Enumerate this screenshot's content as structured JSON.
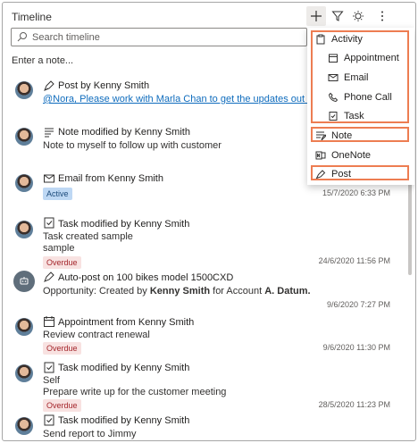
{
  "header": {
    "title": "Timeline"
  },
  "search": {
    "placeholder": "Search timeline"
  },
  "note_input": {
    "placeholder": "Enter a note..."
  },
  "items": [
    {
      "title": "Post by Kenny Smith",
      "link": "@Nora, Please work with Marla Chan to get the updates out today.",
      "icon": "post-icon"
    },
    {
      "title": "Note modified by Kenny Smith",
      "line1": "Note to myself to follow up with customer",
      "icon": "note-icon"
    },
    {
      "title": "Email from Kenny Smith",
      "badge": "Active",
      "timestamp": "15/7/2020 6:33 PM",
      "icon": "email-icon"
    },
    {
      "title": "Task modified by Kenny Smith",
      "line1": "Task created sample",
      "line2": "sample",
      "badge": "Overdue",
      "timestamp": "24/6/2020 11:56 PM",
      "icon": "task-icon"
    },
    {
      "title": "Auto-post on 100 bikes model 1500CXD",
      "line1_prefix": "Opportunity: Created by ",
      "line1_bold1": "Kenny Smith",
      "line1_mid": " for Account ",
      "line1_bold2": "A. Datum.",
      "timestamp": "9/6/2020 7:27 PM",
      "icon": "robot-icon"
    },
    {
      "title": "Appointment from Kenny Smith",
      "line1": "Review contract renewal",
      "badge": "Overdue",
      "timestamp": "9/6/2020 11:30 PM",
      "icon": "calendar-icon"
    },
    {
      "title": "Task modified by Kenny Smith",
      "line1": "Self",
      "line2": "Prepare write up for the customer meeting",
      "badge": "Overdue",
      "timestamp": "28/5/2020 11:23 PM",
      "icon": "task-icon"
    },
    {
      "title": "Task modified by Kenny Smith",
      "line1": "Send report to Jimmy",
      "icon": "task-icon"
    }
  ],
  "menu": {
    "activity": "Activity",
    "appointment": "Appointment",
    "email": "Email",
    "phone_call": "Phone Call",
    "task": "Task",
    "note": "Note",
    "onenote": "OneNote",
    "post": "Post"
  },
  "colors": {
    "highlight": "#ed7d52",
    "link": "#0f6cbd",
    "active_badge": "#bed8f4",
    "overdue_badge": "#f8e2e1"
  }
}
